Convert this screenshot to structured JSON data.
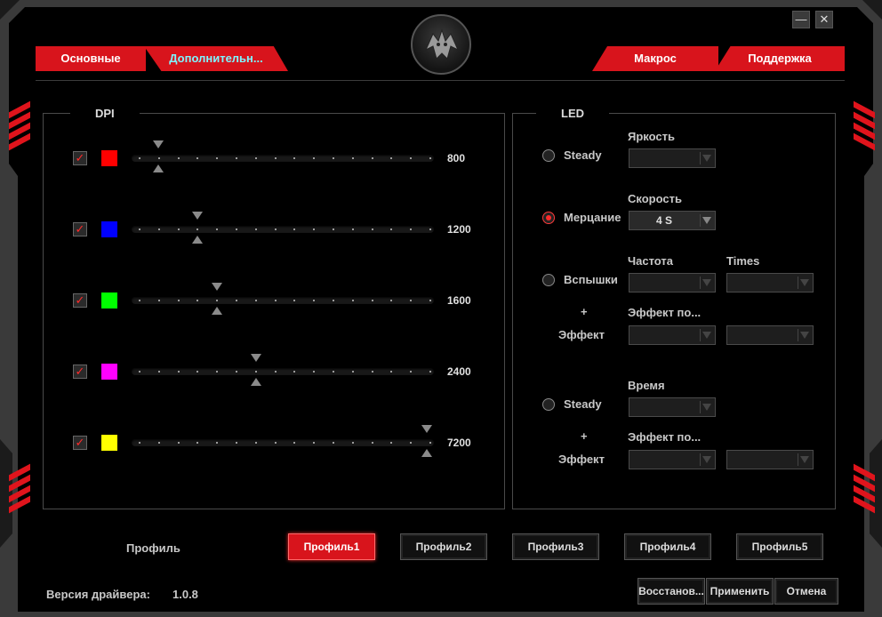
{
  "window": {
    "minimize_label": "—",
    "close_label": "✕"
  },
  "tabs": {
    "left": [
      {
        "label": "Основные"
      },
      {
        "label": "Дополнительн..."
      }
    ],
    "right": [
      {
        "label": "Макрос"
      },
      {
        "label": "Поддержка"
      }
    ]
  },
  "dpi": {
    "title": "DPI",
    "rows": [
      {
        "checked": true,
        "color": "#ff0000",
        "value": "800"
      },
      {
        "checked": true,
        "color": "#0000ff",
        "value": "1200"
      },
      {
        "checked": true,
        "color": "#00ff00",
        "value": "1600"
      },
      {
        "checked": true,
        "color": "#ff00ff",
        "value": "2400"
      },
      {
        "checked": true,
        "color": "#ffff00",
        "value": "7200"
      }
    ]
  },
  "led": {
    "title": "LED",
    "modes": [
      {
        "label": "Steady",
        "selected": false
      },
      {
        "label": "Мерцание",
        "selected": true
      },
      {
        "label": "Вспышки",
        "selected": false
      },
      {
        "label": "Steady",
        "selected": false
      }
    ],
    "field_labels": {
      "brightness": "Яркость",
      "speed": "Скорость",
      "frequency": "Частота",
      "times": "Times",
      "effect_after_1": "Эффект по...",
      "time": "Время",
      "effect_after_2": "Эффект по..."
    },
    "speed_value": "4 S",
    "plus": "+",
    "effect_label": "Эффект"
  },
  "profiles": {
    "label": "Профиль",
    "items": [
      "Профиль1",
      "Профиль2",
      "Профиль3",
      "Профиль4",
      "Профиль5"
    ],
    "active_index": 0
  },
  "footer": {
    "driver_version_label": "Версия драйвера:",
    "driver_version": "1.0.8",
    "restore": "Восстанов...",
    "apply": "Применить",
    "cancel": "Отмена"
  }
}
